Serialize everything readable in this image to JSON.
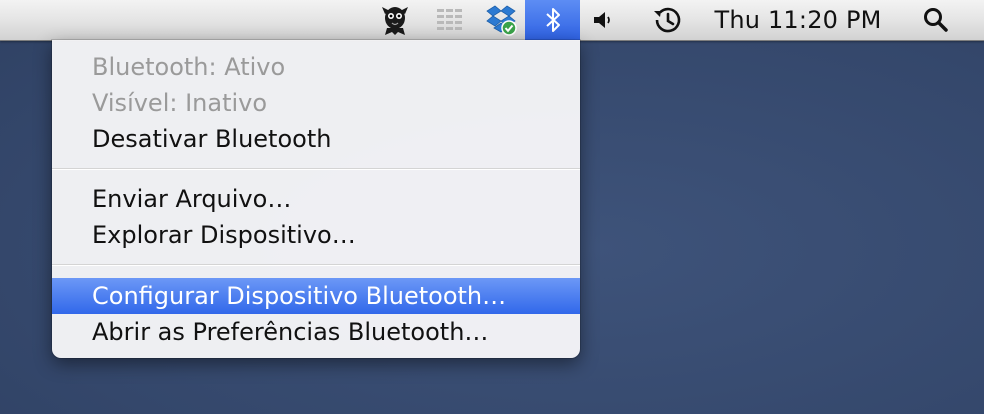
{
  "menubar": {
    "icons": [
      "creature-app-icon",
      "grid-icon",
      "dropbox-icon",
      "bluetooth-icon",
      "volume-icon",
      "time-machine-icon",
      "spotlight-search-icon"
    ],
    "clock": "Thu 11:20 PM",
    "colors": {
      "highlight": "#3168ea",
      "menubar": "#e6e6e6"
    }
  },
  "bluetooth_menu": {
    "status": "Bluetooth:  Ativo",
    "visibility": "Visível: Inativo",
    "toggle": "Desativar Bluetooth",
    "send_file": "Enviar Arquivo…",
    "browse_device": "Explorar Dispositivo…",
    "setup_device": "Configurar Dispositivo Bluetooth…",
    "open_prefs": "Abrir as Preferências Bluetooth…",
    "selected_item": "Configurar Dispositivo Bluetooth…"
  }
}
